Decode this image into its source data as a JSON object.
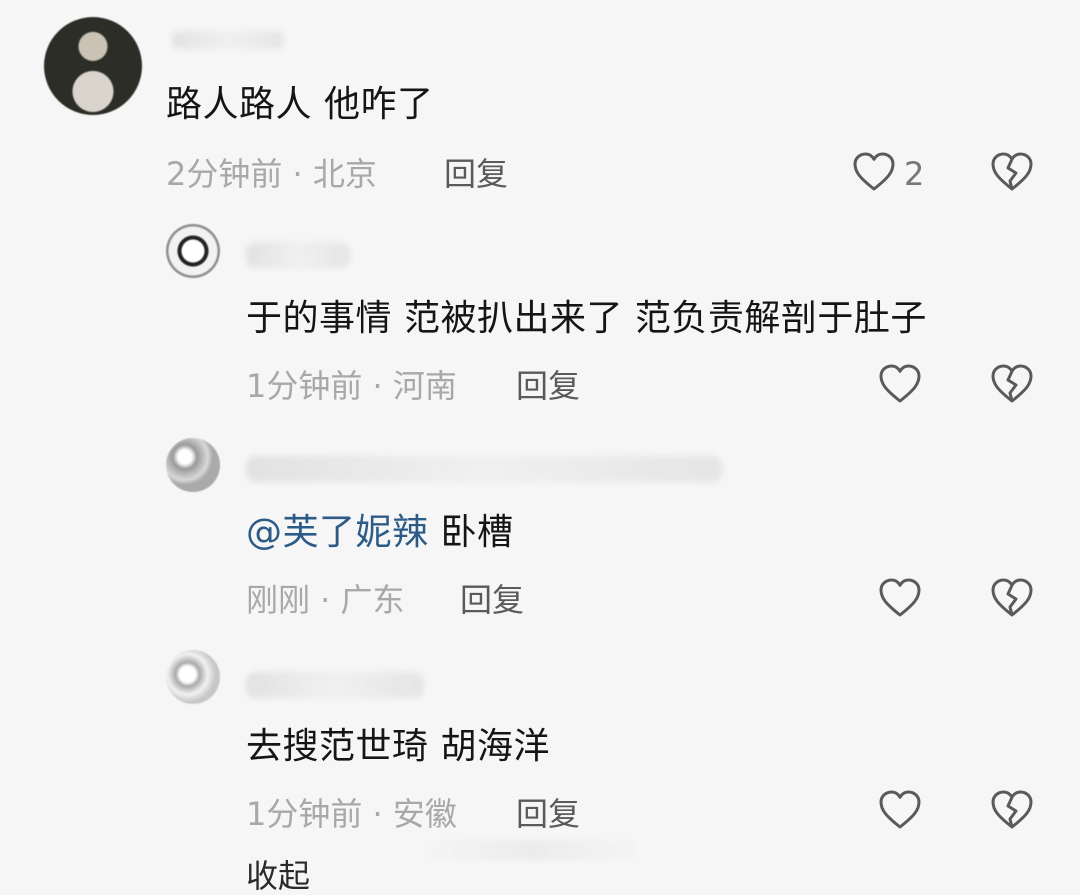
{
  "comments": [
    {
      "text": "路人路人 他咋了",
      "meta": "2分钟前 · 北京",
      "reply": "回复",
      "likes": "2",
      "avatar": "military-avatar"
    },
    {
      "text": "于的事情 范被扒出来了 范负责解剖于肚子",
      "meta": "1分钟前 · 河南",
      "reply": "回复",
      "avatar": "reply-avatar"
    },
    {
      "mention": "@芙了妮辣",
      "text": " 卧槽",
      "meta": "刚刚 · 广东",
      "reply": "回复",
      "avatar": "reply-avatar"
    },
    {
      "text": "去搜范世琦 胡海洋",
      "meta": "1分钟前 · 安徽",
      "reply": "回复",
      "avatar": "reply-avatar"
    }
  ],
  "footer": {
    "collapse": "收起"
  },
  "icons": {
    "like": "heart-outline-icon",
    "dislike": "broken-heart-icon"
  }
}
